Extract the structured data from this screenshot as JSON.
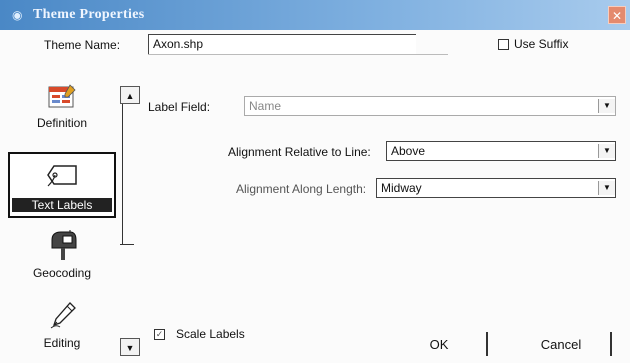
{
  "window": {
    "title": "Theme Properties",
    "close_glyph": "✕"
  },
  "theme_name": {
    "label": "Theme Name:",
    "value": "Axon.shp"
  },
  "use_suffix": {
    "label": "Use Suffix",
    "checked": false
  },
  "label_field": {
    "label": "Label Field:",
    "value": "Name"
  },
  "alignment_line": {
    "label": "Alignment Relative to Line:",
    "value": "Above"
  },
  "alignment_length": {
    "label": "Alignment Along Length:",
    "value": "Midway"
  },
  "scale_labels": {
    "label": "Scale Labels",
    "checked": true
  },
  "buttons": {
    "ok": "OK",
    "cancel": "Cancel"
  },
  "sidebar": {
    "items": [
      {
        "label": "Definition",
        "icon": "definition-icon"
      },
      {
        "label": "Text Labels",
        "icon": "text-labels-icon",
        "selected": true
      },
      {
        "label": "Geocoding",
        "icon": "mailbox-icon"
      },
      {
        "label": "Editing",
        "icon": "pencil-icon"
      }
    ]
  },
  "colors": {
    "titlebar": "#4a88c6",
    "close": "#e48a6e",
    "definition_icon": "#d84a2a"
  }
}
